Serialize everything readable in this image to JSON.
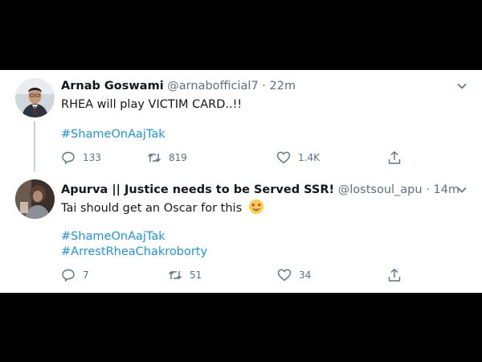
{
  "tweets": [
    {
      "name": "Arnab Goswami",
      "handle": "@arnabofficial7",
      "separator": "·",
      "time": "22m",
      "text": "RHEA will play VICTIM CARD..!!",
      "hashtags": [
        "#ShameOnAajTak"
      ],
      "replies": "133",
      "retweets": "819",
      "likes": "1.4K"
    },
    {
      "name": "Apurva || Justice needs to be Served SSR!",
      "handle": "@lostsoul_apu",
      "separator": "·",
      "time": "14m",
      "text": "Tai should get an Oscar for this",
      "emoji": "star-struck-emoji",
      "hashtags": [
        "#ShameOnAajTak",
        "#ArrestRheaChakroborty"
      ],
      "replies": "7",
      "retweets": "51",
      "likes": "34"
    }
  ],
  "colors": {
    "background": "#000000",
    "card": "#ffffff",
    "name": "#14171a",
    "secondary": "#5b7083",
    "hashtag": "#1b95e0",
    "thread_line": "#c4cfd6"
  }
}
